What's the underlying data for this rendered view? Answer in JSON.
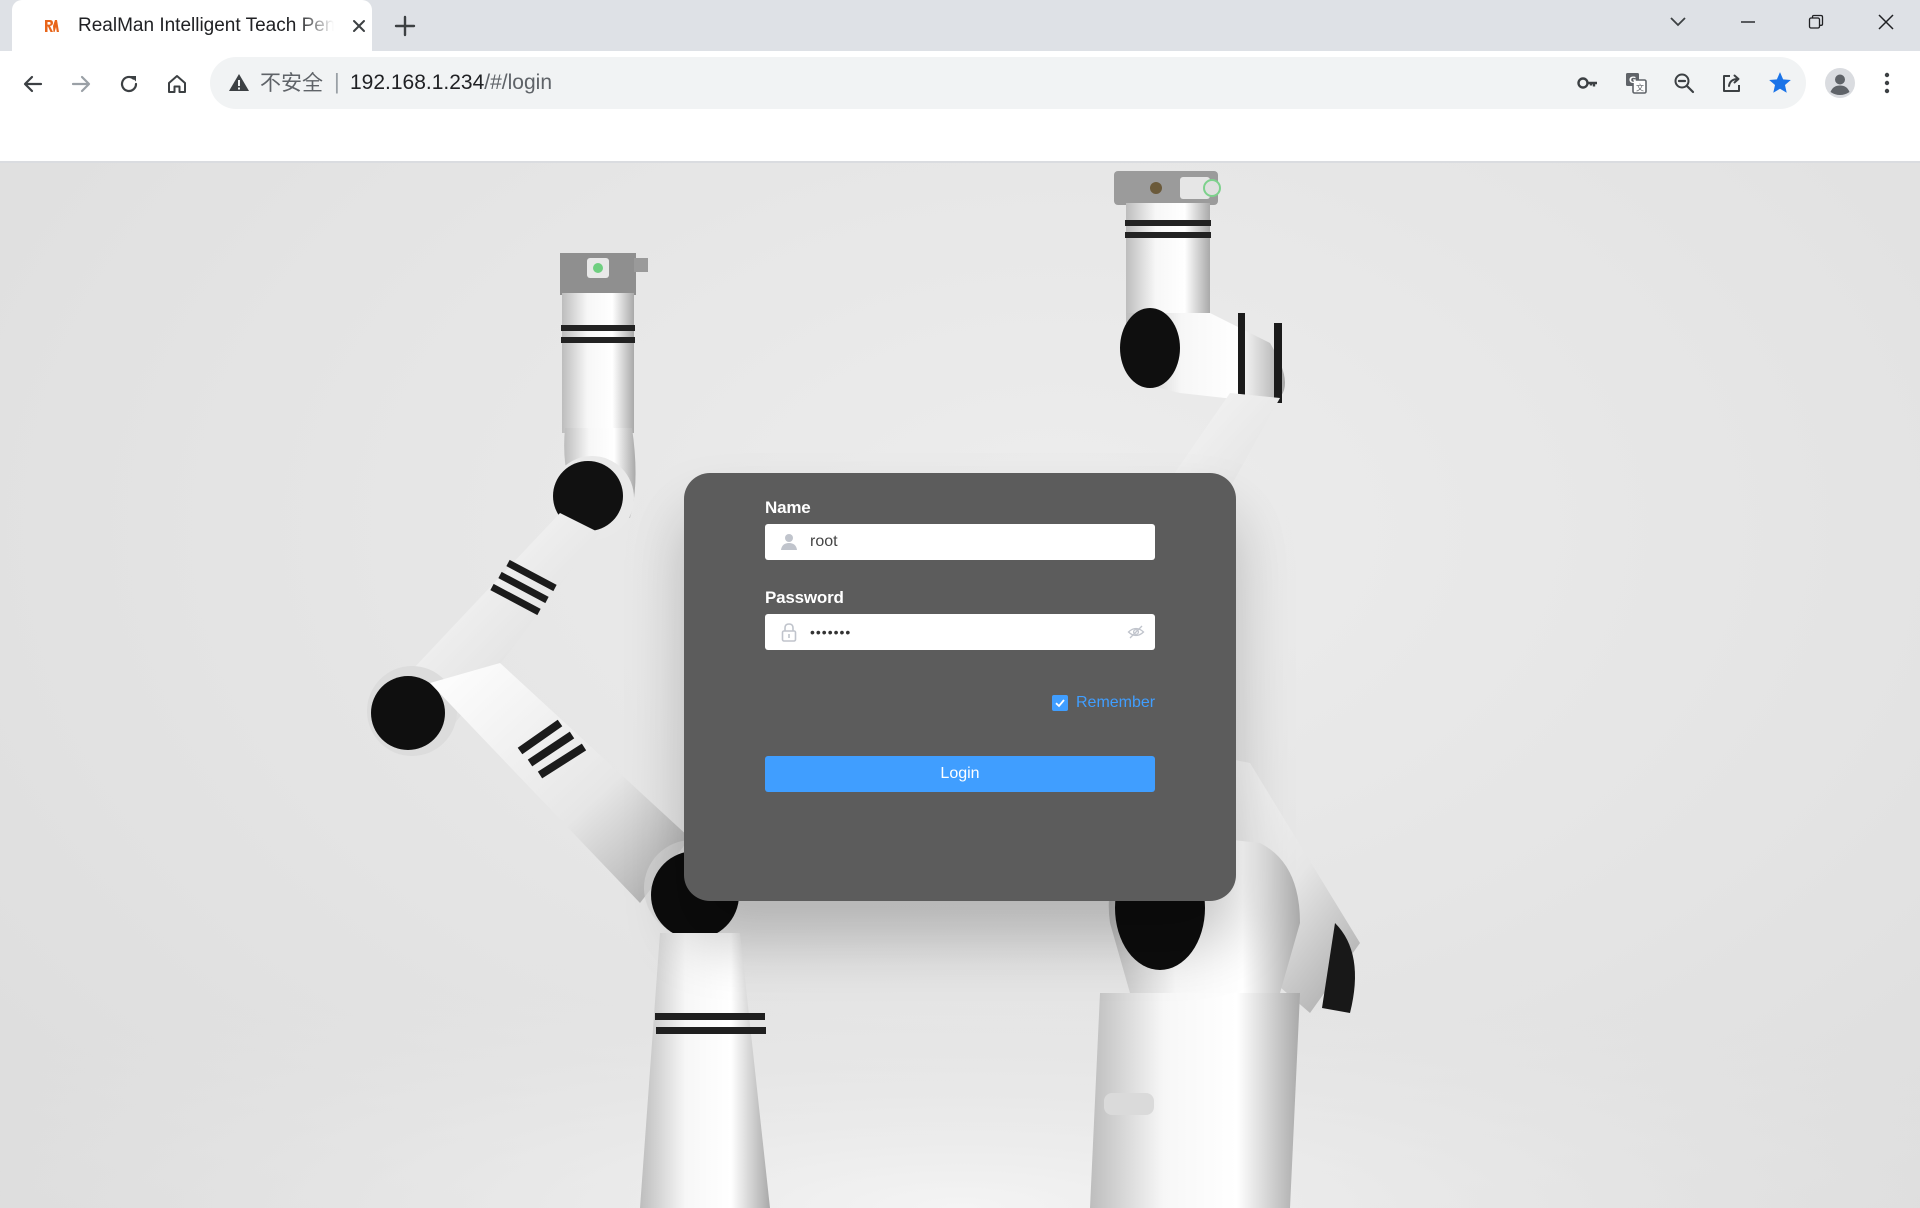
{
  "browser": {
    "tab": {
      "title": "RealMan Intelligent Teach Pendant",
      "favicon": "realman-logo"
    },
    "new_tab_symbol": "+",
    "address_bar": {
      "security_label": "不安全",
      "separator": "|",
      "host": "192.168.1.234",
      "path": "/#/login"
    },
    "icons": {
      "back": "arrow-left-icon",
      "forward": "arrow-right-icon",
      "reload": "reload-icon",
      "home": "home-icon",
      "warning": "warning-icon",
      "key": "key-icon",
      "translate": "translate-icon",
      "zoom": "zoom-out-icon",
      "share": "share-icon",
      "bookmark": "star-icon",
      "profile": "avatar-icon",
      "menu": "kebab-menu-icon"
    },
    "colors": {
      "tab_strip": "#dee1e6",
      "omnibox": "#f1f3f4",
      "bookmark_star": "#1a73e8"
    }
  },
  "login": {
    "name_label": "Name",
    "name_value": "root",
    "password_label": "Password",
    "password_value": "•••••••",
    "remember_label": "Remember",
    "remember_checked": true,
    "login_button": "Login",
    "colors": {
      "card_bg": "#5c5c5c",
      "accent": "#409eff"
    }
  }
}
